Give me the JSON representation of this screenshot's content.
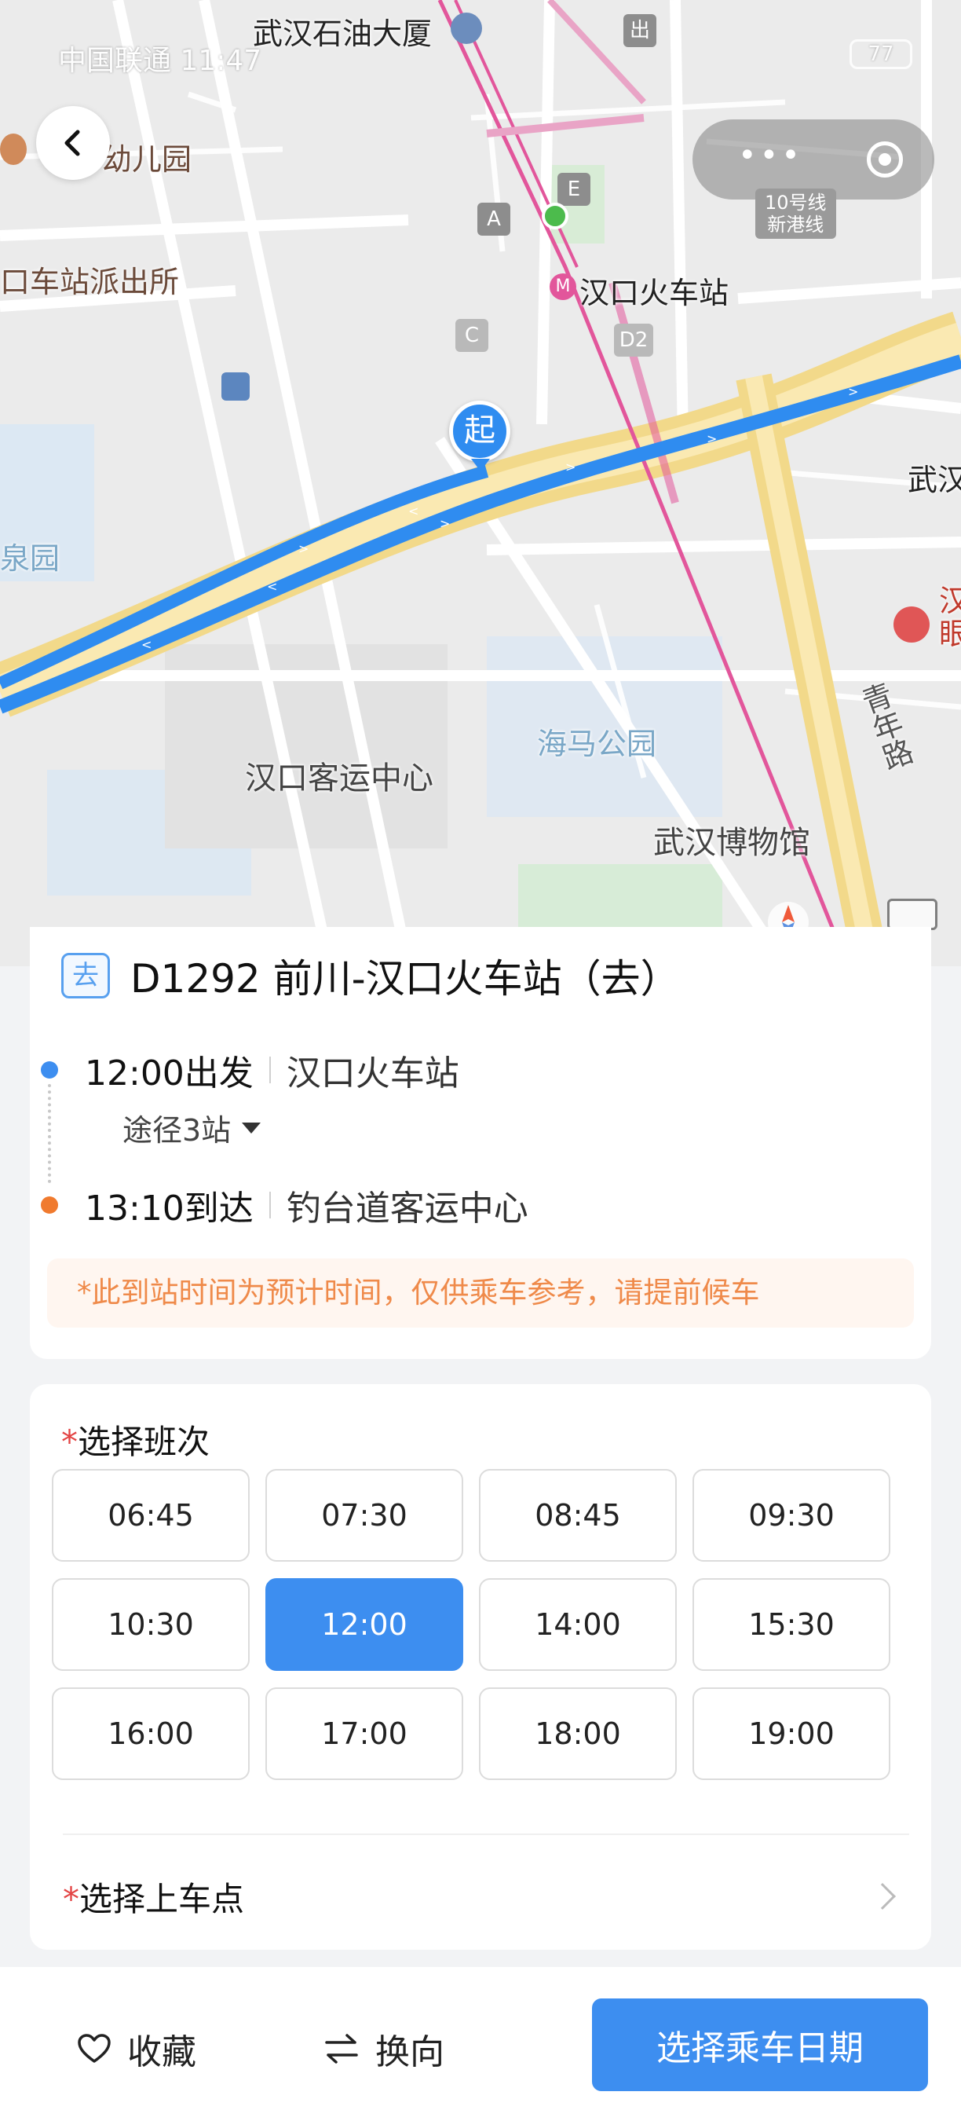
{
  "status_bar": {
    "carrier": "中国联通 11:47",
    "battery": "77"
  },
  "map": {
    "labels": {
      "building": "武汉石油大厦",
      "kindergarten": "幼儿园",
      "police": "口车站派出所",
      "hankou_station": "汉口火车站",
      "park_left": "泉园",
      "hub": "汉口客运中心",
      "haima_park": "海马公园",
      "museum": "武汉博物馆",
      "qingnian_road": "青年路",
      "wuhan_right": "武汉",
      "han_right": "汉\n眼"
    },
    "exits": {
      "a": "A",
      "c": "C",
      "d2": "D2",
      "e": "E",
      "out": "出"
    },
    "line_badge": "10号线\n新港线",
    "start_marker": "起"
  },
  "route": {
    "tag": "去",
    "title": "D1292 前川-汉口火车站（去）",
    "departure": {
      "time": "12:00出发",
      "station": "汉口火车站"
    },
    "via": "途径3站",
    "arrival": {
      "time": "13:10到达",
      "station": "钓台道客运中心"
    },
    "notice": "*此到站时间为预计时间，仅供乘车参考，请提前候车"
  },
  "schedule": {
    "title_mark": "*",
    "title": "选择班次",
    "selected": "12:00",
    "times": [
      "06:45",
      "07:30",
      "08:45",
      "09:30",
      "10:30",
      "12:00",
      "14:00",
      "15:30",
      "16:00",
      "17:00",
      "18:00",
      "19:00"
    ],
    "boarding_mark": "*",
    "boarding_title": "选择上车点"
  },
  "bottom_bar": {
    "favorite": "收藏",
    "switch": "换向",
    "primary": "选择乘车日期"
  },
  "colors": {
    "accent": "#3d8ef0",
    "route_blue": "#2f8cf0",
    "metro_pink": "#e2569b",
    "notice_text": "#ef8a4a",
    "required_red": "#e34444"
  }
}
